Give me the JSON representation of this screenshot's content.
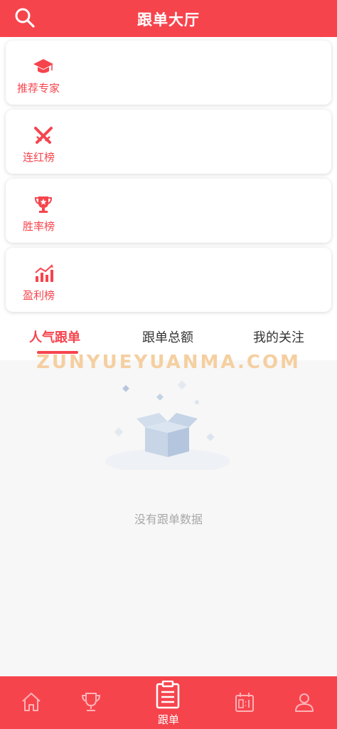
{
  "header": {
    "title": "跟单大厅",
    "search_icon": "search-icon"
  },
  "menu": [
    {
      "label": "推荐专家",
      "icon": "graduation-cap-icon"
    },
    {
      "label": "连红榜",
      "icon": "crossed-swords-icon"
    },
    {
      "label": "胜率榜",
      "icon": "trophy-icon"
    },
    {
      "label": "盈利榜",
      "icon": "bar-chart-icon"
    }
  ],
  "tabs": [
    {
      "label": "人气跟单",
      "active": true
    },
    {
      "label": "跟单总额",
      "active": false
    },
    {
      "label": "我的关注",
      "active": false
    }
  ],
  "watermark": "ZUNYUEYUANMA.COM",
  "empty": {
    "text": "没有跟单数据",
    "icon": "empty-box-icon"
  },
  "tabbar": {
    "items": [
      {
        "icon": "home-icon"
      },
      {
        "icon": "trophy-icon"
      },
      {
        "icon": "clipboard-icon",
        "label": "跟单",
        "active": true
      },
      {
        "icon": "scoreboard-icon"
      },
      {
        "icon": "user-icon"
      }
    ]
  },
  "colors": {
    "accent": "#f6444d",
    "background": "#f7f7f7",
    "watermark": "#f5cfa0"
  }
}
